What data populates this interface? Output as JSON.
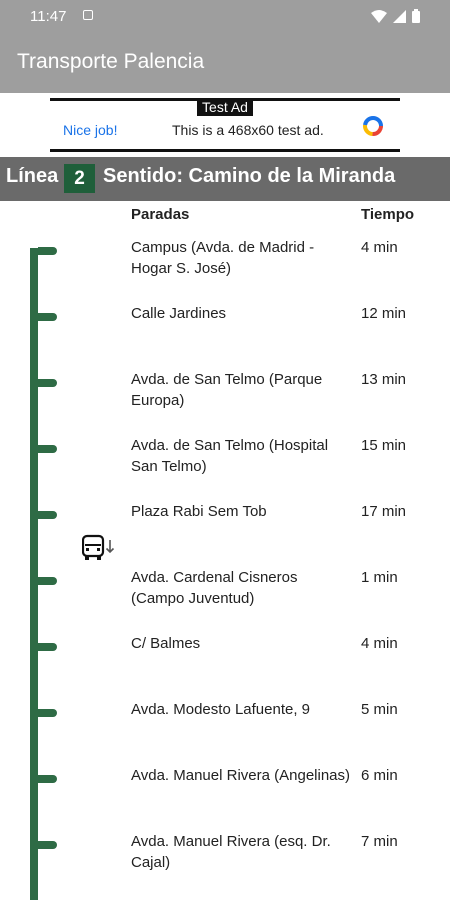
{
  "status_bar": {
    "time": "11:47"
  },
  "app_bar": {
    "title": "Transporte Palencia"
  },
  "ad": {
    "label": "Test Ad",
    "headline": "Nice job!",
    "text": "This is a 468x60 test ad."
  },
  "line_header": {
    "linea_label": "Línea",
    "linea_number": "2",
    "sentido": "Sentido: Camino de la Miranda",
    "color": "#1f5f3a"
  },
  "table": {
    "col_paradas": "Paradas",
    "col_tiempo": "Tiempo",
    "stops": [
      {
        "name": "Campus (Avda. de Madrid - Hogar S. José)",
        "time": "4 min"
      },
      {
        "name": "Calle Jardines",
        "time": "12 min"
      },
      {
        "name": "Avda. de San Telmo (Parque Europa)",
        "time": "13 min"
      },
      {
        "name": "Avda. de San Telmo (Hospital San Telmo)",
        "time": "15 min"
      },
      {
        "name": "Plaza Rabi Sem Tob",
        "time": "17 min"
      },
      {
        "name": "Avda. Cardenal Cisneros (Campo Juventud)",
        "time": "1 min"
      },
      {
        "name": "C/ Balmes",
        "time": "4 min"
      },
      {
        "name": "Avda. Modesto Lafuente, 9",
        "time": "5 min"
      },
      {
        "name": "Avda. Manuel Rivera (Angelinas)",
        "time": "6 min"
      },
      {
        "name": "Avda. Manuel Rivera (esq. Dr. Cajal)",
        "time": "7 min"
      }
    ]
  },
  "icons": {
    "bus": "bus-icon",
    "route": "route-line",
    "wifi": "wifi-icon",
    "signal": "signal-icon",
    "battery": "battery-icon"
  },
  "colors": {
    "route": "#2e6b45",
    "appbar": "#9e9e9e",
    "line_bar": "#6a6a6a"
  }
}
